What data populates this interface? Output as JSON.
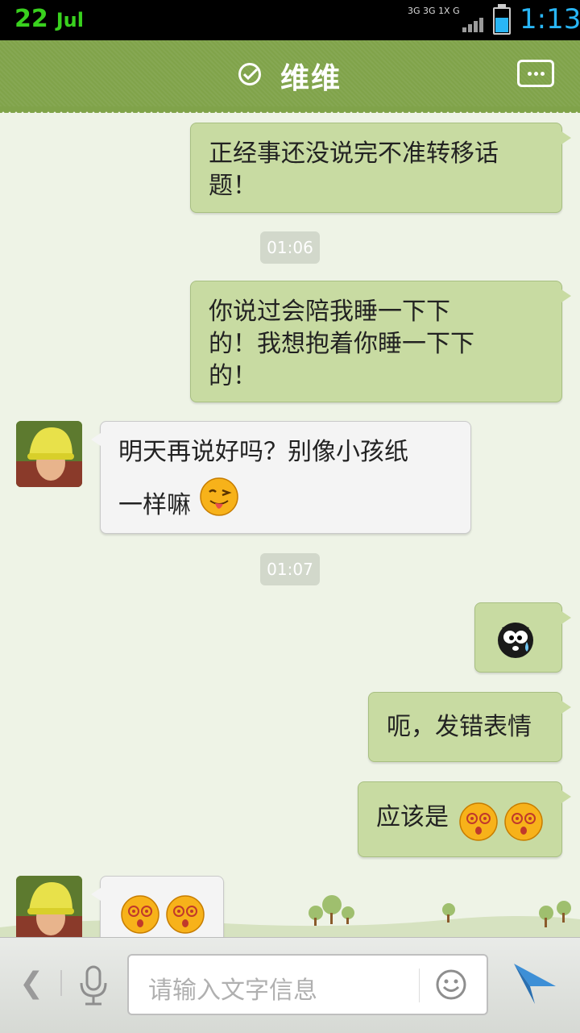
{
  "status_bar": {
    "day": "22",
    "month": "Jul",
    "net_labels": [
      "3G",
      "3G",
      "1X",
      "G"
    ],
    "time": "1:13"
  },
  "header": {
    "title": "维维",
    "verified_icon": "check-circle-icon",
    "more_icon": "chat-more-icon"
  },
  "messages": [
    {
      "dir": "out",
      "text_lines": [
        "正经事还没说完不准转移话",
        "题！"
      ]
    },
    {
      "type": "timestamp",
      "text": "01:06"
    },
    {
      "dir": "out",
      "text_lines": [
        "你说过会陪我睡一下下",
        "的！我想抱着你睡一下下",
        "的！"
      ]
    },
    {
      "dir": "in",
      "text_lines": [
        "明天再说好吗？别像小孩纸",
        "一样嘛"
      ],
      "emoji": "wink-tongue-emoji"
    },
    {
      "type": "timestamp",
      "text": "01:07"
    },
    {
      "dir": "out",
      "emoji": "black-face-sweat-emoji"
    },
    {
      "dir": "out",
      "text": "呃，发错表情"
    },
    {
      "dir": "out",
      "text": "应该是",
      "emoji": "dizzy-face-emoji",
      "emoji_count": 2
    },
    {
      "dir": "in",
      "emoji": "dizzy-face-emoji",
      "emoji_count": 2
    }
  ],
  "input_bar": {
    "placeholder": "请输入文字信息",
    "icons": [
      "back-chevron-icon",
      "microphone-icon",
      "smiley-icon",
      "send-icon"
    ]
  },
  "colors": {
    "header": "#80a34a",
    "outgoing_bubble": "#c8dba2",
    "incoming_bubble": "#f4f4f4",
    "chat_background": "#eef3e6",
    "time_text": "#29b6f6"
  }
}
